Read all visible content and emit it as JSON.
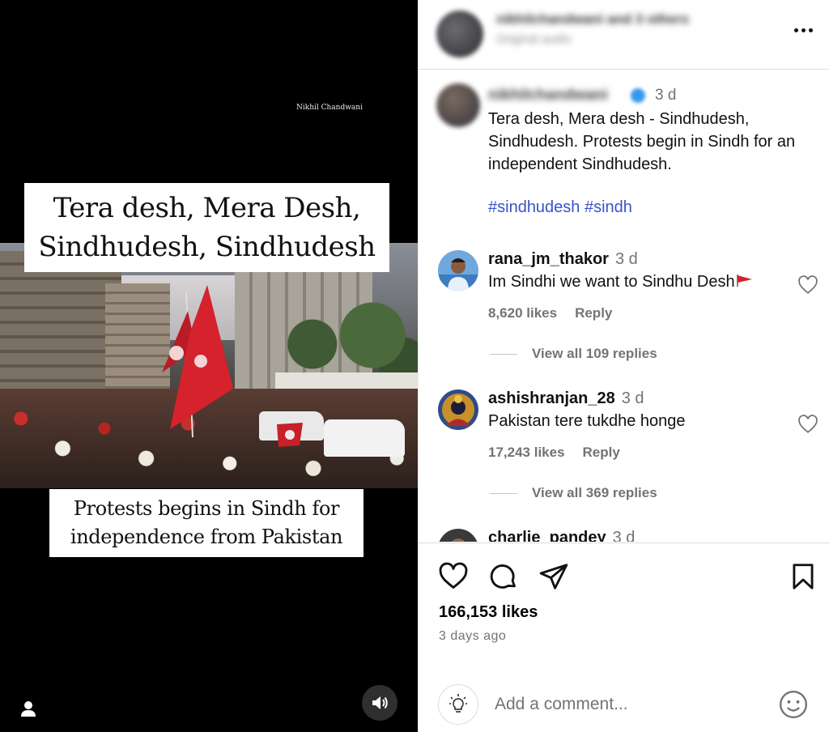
{
  "video": {
    "watermark": "Nikhil Chandwani",
    "headline_line1": "Tera desh, Mera Desh,",
    "headline_line2": "Sindhudesh, Sindhudesh",
    "subline_line1": "Protests begins in Sindh for",
    "subline_line2": "independence from Pakistan"
  },
  "header": {
    "username_blurred": "nikhilchandwani and 3 others",
    "audio_blurred": "Original audio"
  },
  "caption": {
    "username_blurred": "nikhilchandwani",
    "time": "3 d",
    "text": "Tera desh, Mera desh - Sindhudesh, Sindhudesh. Protests begin in Sindh for an independent Sindhudesh.",
    "hashtags": "#sindhudesh #sindh"
  },
  "comments": [
    {
      "username": "rana_jm_thakor",
      "time": "3 d",
      "text": "Im Sindhi we want to Sindhu Desh",
      "likes": "8,620 likes",
      "reply_label": "Reply",
      "view_replies": "View all 109 replies"
    },
    {
      "username": "ashishranjan_28",
      "time": "3 d",
      "text": "Pakistan tere tukdhe honge",
      "likes": "17,243 likes",
      "reply_label": "Reply",
      "view_replies": "View all 369 replies"
    },
    {
      "username": "charlie_pandey",
      "time": "3 d"
    }
  ],
  "post": {
    "likes": "166,153 likes",
    "posted": "3 days ago"
  },
  "comment_box": {
    "placeholder": "Add a comment..."
  },
  "colors": {
    "link_blue": "#3a53c9",
    "muted": "#737373",
    "flag_red": "#c8202a"
  },
  "icons": [
    "user-tag-icon",
    "speaker-icon",
    "more-icon",
    "heart-icon",
    "comment-icon",
    "share-icon",
    "bookmark-icon",
    "lightbulb-icon",
    "emoji-icon",
    "red-flag-emoji"
  ]
}
